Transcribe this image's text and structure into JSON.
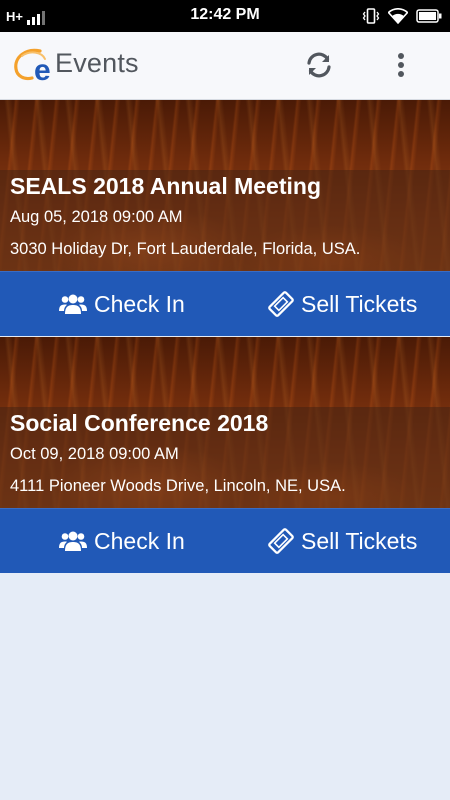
{
  "status_bar": {
    "network": "H+",
    "time": "12:42 PM",
    "icons": [
      "signal-bars-icon",
      "vibrate-icon",
      "wifi-icon",
      "battery-icon"
    ]
  },
  "app_bar": {
    "title": "Events",
    "logo_letter": "e",
    "icons": [
      "refresh-icon",
      "overflow-menu-icon"
    ],
    "colors": {
      "logo_orange": "#f4a12c",
      "logo_blue": "#2159b7",
      "title": "#52575e"
    }
  },
  "events": [
    {
      "title": "SEALS 2018 Annual Meeting",
      "date": "Aug 05, 2018 09:00 AM",
      "address": "3030 Holiday Dr, Fort Lauderdale, Florida, USA.",
      "check_in_label": "Check In",
      "sell_tickets_label": "Sell Tickets"
    },
    {
      "title": "Social Conference 2018",
      "date": "Oct 09, 2018 09:00 AM",
      "address": "4111 Pioneer Woods Drive, Lincoln, NE, USA.",
      "check_in_label": "Check In",
      "sell_tickets_label": "Sell Tickets"
    }
  ],
  "colors": {
    "action_bar": "#2159b7",
    "background": "#e5ecf7"
  }
}
